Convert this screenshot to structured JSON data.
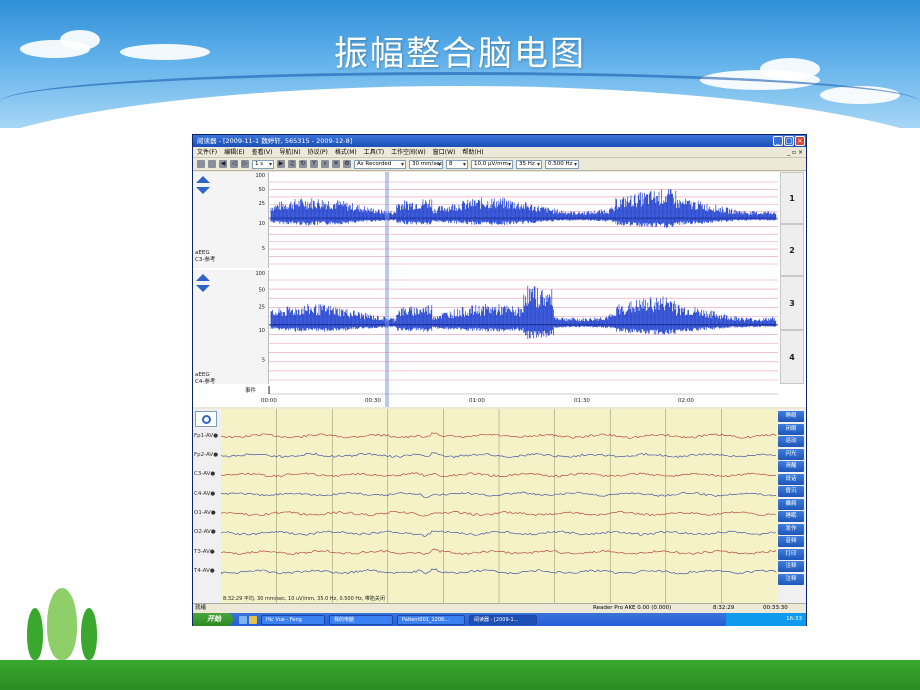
{
  "slide": {
    "title": "振幅整合脑电图"
  },
  "window": {
    "title": "阅读器 - [2009-11-1 魏婷轩, 565315 - 2009-12-8]",
    "controls": [
      "_",
      "□",
      "×"
    ],
    "mdi_controls": "_ ▫ ×"
  },
  "menu": {
    "items": [
      "文件(F)",
      "编辑(E)",
      "查看(V)",
      "导航(N)",
      "协议(P)",
      "格式(M)",
      "工具(T)",
      "工作空间(W)",
      "窗口(W)",
      "帮助(H)"
    ]
  },
  "toolbar": {
    "page_value": "1 s",
    "montage_value": "As Recorded",
    "speed_value": "30 mm/sec",
    "channels_value": "8",
    "sensitivity_value": "10.0 μV/mm",
    "hf_value": "35 Hz",
    "lf_value": "0.500 Hz"
  },
  "aeeg": {
    "scale_ticks": [
      "100",
      "50",
      "25",
      "10",
      "5"
    ],
    "channel1_label": "aEEG\nC3-参考",
    "channel2_label": "aEEG\nC4-参考",
    "page_buttons": [
      "1",
      "2",
      "3",
      "4"
    ],
    "event_label": "事件",
    "time_ticks": [
      "00:00",
      "00:30",
      "01:00",
      "01:30",
      "02:00"
    ]
  },
  "eeg": {
    "channels": [
      "Fp1-AV●",
      "Fp2-AV●",
      "C3-AV●",
      "C4-AV●",
      "O1-AV●",
      "O2-AV●",
      "T3-AV●",
      "T4-AV●"
    ],
    "channel_colors": [
      "#b03030",
      "#3040a0",
      "#b03030",
      "#3040a0",
      "#b03030",
      "#3040a0",
      "#b03030",
      "#3040a0"
    ],
    "info_line": "8:32:29 平均, 30 mm/sec, 10 uV/mm, 35.0 Hz, 0.500 Hz, 带陷关闭",
    "event_buttons": [
      "睁眼",
      "闭眼",
      "运动",
      "闪光",
      "清醒",
      "说话",
      "昏沉",
      "癫痫",
      "睡眠",
      "发作",
      "音频",
      "打印",
      "注释",
      "注释"
    ]
  },
  "status": {
    "left": "就绪",
    "reader": "Reader Pro  AKE  0.00  (0.000)",
    "time": "8:32:29",
    "duration": "00:33:30"
  },
  "taskbar": {
    "start_label": "开始",
    "tasks": [
      "Hic Vue - Feng",
      "我的电脑",
      "Patient001_1208...",
      "阅读器 - [2009-1..."
    ],
    "clock": "16:33"
  }
}
